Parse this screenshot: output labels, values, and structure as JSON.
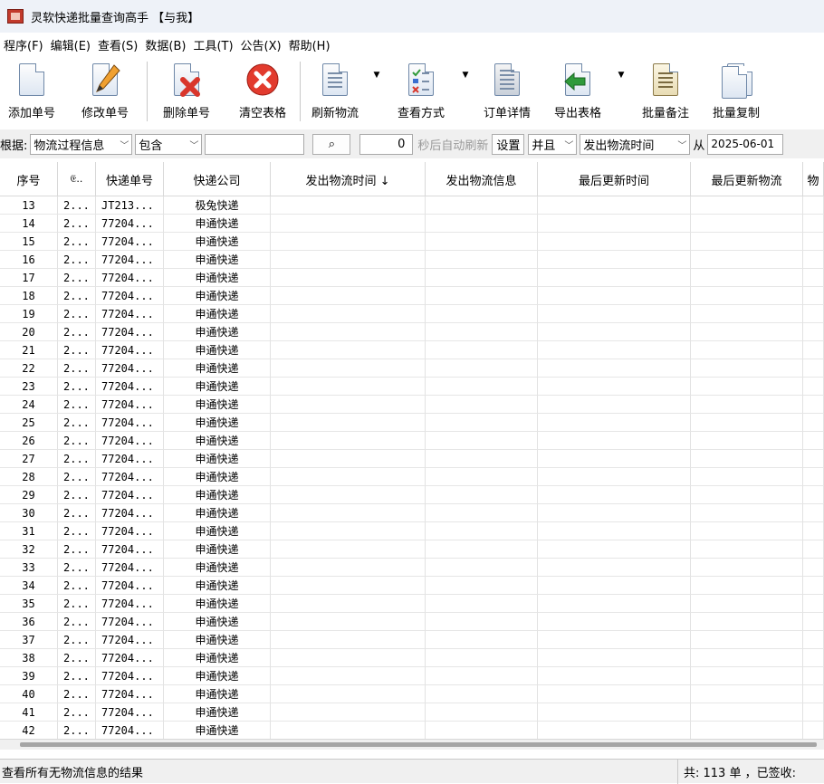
{
  "window": {
    "title": "灵软快递批量查询高手 【与我】"
  },
  "menu": [
    "程序(F)",
    "编辑(E)",
    "查看(S)",
    "数据(B)",
    "工具(T)",
    "公告(X)",
    "帮助(H)"
  ],
  "toolbar": {
    "add": "添加单号",
    "edit": "修改单号",
    "delete": "删除单号",
    "clear": "清空表格",
    "refresh": "刷新物流",
    "view_mode": "查看方式",
    "order_detail": "订单详情",
    "export": "导出表格",
    "batch_note": "批量备注",
    "batch_copy": "批量复制"
  },
  "filter": {
    "by_label": "根据:",
    "field": "物流过程信息",
    "op": "包含",
    "keyword": "",
    "count": "0",
    "auto_refresh": "秒后自动刷新",
    "settings": "设置",
    "logic": "并且",
    "time_field": "发出物流时间",
    "from_label": "从",
    "from_date": "2025-06-01"
  },
  "table": {
    "columns": [
      "序号",
      "<truncated>",
      "快递单号",
      "快递公司",
      "发出物流时间 ↓",
      "发出物流信息",
      "最后更新时间",
      "最后更新物流",
      "<truncated>"
    ],
    "rows": [
      [
        "13",
        "2...",
        "JT213...",
        "极兔快递"
      ],
      [
        "14",
        "2...",
        "77204...",
        "申通快递"
      ],
      [
        "15",
        "2...",
        "77204...",
        "申通快递"
      ],
      [
        "16",
        "2...",
        "77204...",
        "申通快递"
      ],
      [
        "17",
        "2...",
        "77204...",
        "申通快递"
      ],
      [
        "18",
        "2...",
        "77204...",
        "申通快递"
      ],
      [
        "19",
        "2...",
        "77204...",
        "申通快递"
      ],
      [
        "20",
        "2...",
        "77204...",
        "申通快递"
      ],
      [
        "21",
        "2...",
        "77204...",
        "申通快递"
      ],
      [
        "22",
        "2...",
        "77204...",
        "申通快递"
      ],
      [
        "23",
        "2...",
        "77204...",
        "申通快递"
      ],
      [
        "24",
        "2...",
        "77204...",
        "申通快递"
      ],
      [
        "25",
        "2...",
        "77204...",
        "申通快递"
      ],
      [
        "26",
        "2...",
        "77204...",
        "申通快递"
      ],
      [
        "27",
        "2...",
        "77204...",
        "申通快递"
      ],
      [
        "28",
        "2...",
        "77204...",
        "申通快递"
      ],
      [
        "29",
        "2...",
        "77204...",
        "申通快递"
      ],
      [
        "30",
        "2...",
        "77204...",
        "申通快递"
      ],
      [
        "31",
        "2...",
        "77204...",
        "申通快递"
      ],
      [
        "32",
        "2...",
        "77204...",
        "申通快递"
      ],
      [
        "33",
        "2...",
        "77204...",
        "申通快递"
      ],
      [
        "34",
        "2...",
        "77204...",
        "申通快递"
      ],
      [
        "35",
        "2...",
        "77204...",
        "申通快递"
      ],
      [
        "36",
        "2...",
        "77204...",
        "申通快递"
      ],
      [
        "37",
        "2...",
        "77204...",
        "申通快递"
      ],
      [
        "38",
        "2...",
        "77204...",
        "申通快递"
      ],
      [
        "39",
        "2...",
        "77204...",
        "申通快递"
      ],
      [
        "40",
        "2...",
        "77204...",
        "申通快递"
      ],
      [
        "41",
        "2...",
        "77204...",
        "申通快递"
      ],
      [
        "42",
        "2...",
        "77204...",
        "申通快递"
      ]
    ]
  },
  "status": {
    "left": "查看所有无物流信息的结果",
    "right": "共: 113 单 ，已签收:"
  },
  "colors": {
    "delete_red": "#d9362b",
    "clear_red": "#e23b2e",
    "export_green": "#2f9a3a",
    "edit_orange": "#f0a030"
  }
}
